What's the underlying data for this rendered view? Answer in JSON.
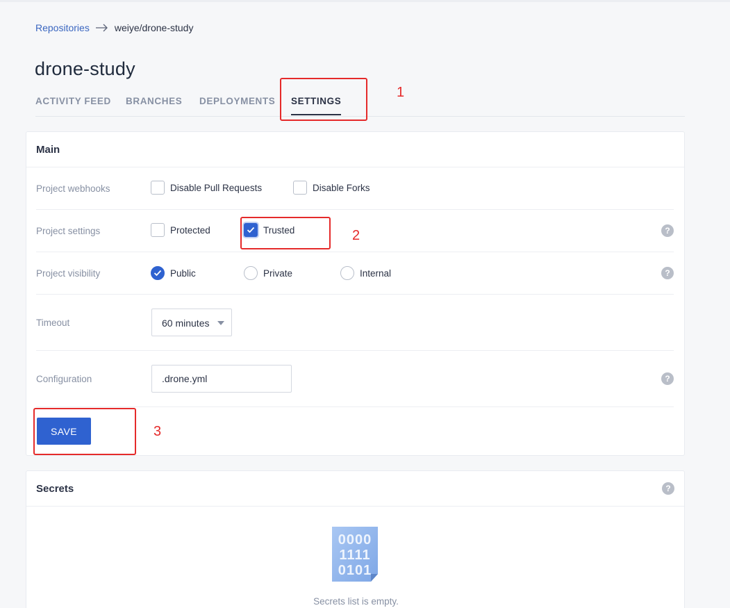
{
  "breadcrumb": {
    "root": "Repositories",
    "current": "weiye/drone-study"
  },
  "page_title": "drone-study",
  "tabs": [
    {
      "label": "ACTIVITY FEED",
      "active": false
    },
    {
      "label": "BRANCHES",
      "active": false
    },
    {
      "label": "DEPLOYMENTS",
      "active": false
    },
    {
      "label": "SETTINGS",
      "active": true
    }
  ],
  "main": {
    "title": "Main",
    "webhooks": {
      "label": "Project webhooks",
      "options": [
        {
          "label": "Disable Pull Requests",
          "checked": false
        },
        {
          "label": "Disable Forks",
          "checked": false
        }
      ]
    },
    "settings": {
      "label": "Project settings",
      "options": [
        {
          "label": "Protected",
          "checked": false
        },
        {
          "label": "Trusted",
          "checked": true
        }
      ],
      "help": "?"
    },
    "visibility": {
      "label": "Project visibility",
      "options": [
        {
          "label": "Public",
          "selected": true
        },
        {
          "label": "Private",
          "selected": false
        },
        {
          "label": "Internal",
          "selected": false
        }
      ],
      "help": "?"
    },
    "timeout": {
      "label": "Timeout",
      "value": "60 minutes"
    },
    "configuration": {
      "label": "Configuration",
      "value": ".drone.yml",
      "help": "?"
    },
    "save_label": "SAVE"
  },
  "secrets": {
    "title": "Secrets",
    "help": "?",
    "icon_rows": [
      "0000",
      "1111",
      "0101"
    ],
    "empty_text": "Secrets list is empty."
  },
  "annotations": [
    "1",
    "2",
    "3"
  ],
  "colors": {
    "accent": "#2f62d0",
    "annotation": "#e52a2a",
    "link": "#3a66c0"
  }
}
